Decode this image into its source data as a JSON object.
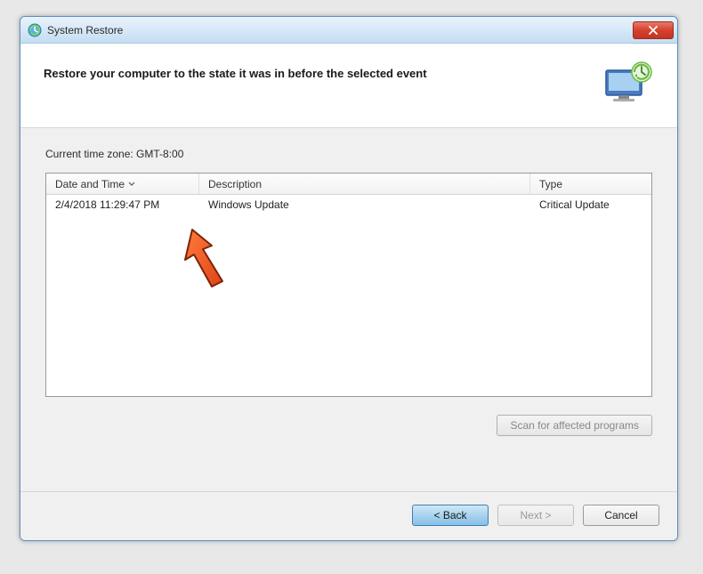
{
  "window": {
    "title": "System Restore",
    "close_icon": "close-icon"
  },
  "header": {
    "heading": "Restore your computer to the state it was in before the selected event"
  },
  "body": {
    "timezone_label": "Current time zone: GMT-8:00",
    "columns": {
      "datetime": "Date and Time",
      "description": "Description",
      "type": "Type"
    },
    "rows": [
      {
        "datetime": "2/4/2018 11:29:47 PM",
        "description": "Windows Update",
        "type": "Critical Update"
      }
    ],
    "scan_button": "Scan for affected programs"
  },
  "footer": {
    "back": "< Back",
    "next": "Next >",
    "cancel": "Cancel"
  }
}
